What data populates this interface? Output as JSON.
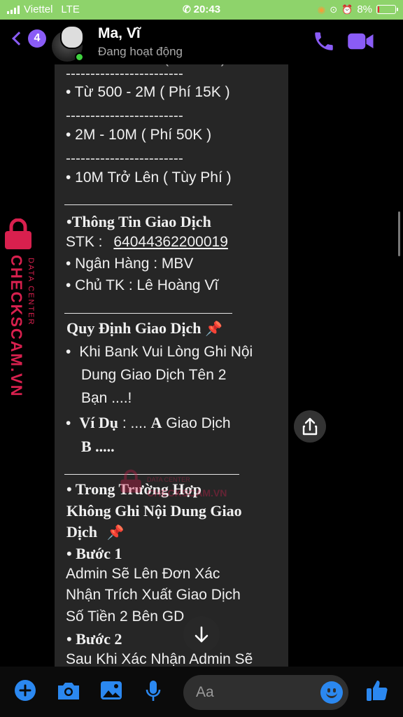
{
  "status_bar": {
    "carrier": "Viettel",
    "network": "LTE",
    "time": "20:43",
    "battery": "8%",
    "battery_level": 0.08
  },
  "header": {
    "back_count": "4",
    "contact_name": "Ma, Vĩ",
    "contact_status": "Đang hoạt động"
  },
  "message": {
    "separator": "------------------------",
    "tier_500_2m": "• Từ 500 - 2M ( Phí 15K )",
    "tier_2m_10m": "• 2M - 10M ( Phí 50K )",
    "tier_10m": "• 10M Trở Lên ( Tùy Phí )",
    "info_heading": "•Thông Tin Giao Dịch",
    "stk_label": "STK :",
    "stk_value": "64044362200019",
    "bank": "• Ngân Hàng : MBV",
    "owner": "• Chủ TK  : Lê Hoàng Vĩ",
    "rules_heading": "Quy Định Giao Dịch",
    "rule1_line1": "Khi Bank Vui Lòng Ghi Nội",
    "rule1_line2": "Dung Giao Dịch Tên 2",
    "rule1_line3": "Bạn ....!",
    "rule2_prefix": "Ví Dụ",
    "rule2_mid": " : .... ",
    "rule2_a": "A",
    "rule2_rest": " Giao Dịch",
    "rule2_b": "B .....",
    "case_line1": "• Trong Trường Hợp",
    "case_line2": "Không Ghi Nội Dung Giao",
    "case_line3": "Dịch",
    "step1": "• Bước 1",
    "step1_line1": "Admin Sẽ Lên Đơn Xác",
    "step1_line2": "Nhận Trích Xuất Giao Dịch",
    "step1_line3": "Số Tiền 2 Bên GD",
    "step2": "• Bước 2",
    "step2_line1": "Sau Khi Xác Nhận Admin Sẽ"
  },
  "watermark": {
    "brand": "CHECKSCAM.VN",
    "sub": "DATA CENTER",
    "center_brand": "CHECKSCAM.VN",
    "center_sub": "DATA CENTER"
  },
  "composer": {
    "placeholder": "Aa"
  },
  "colors": {
    "accent": "#8a5cf6",
    "status_bar": "#8ed36b",
    "composer_icons": "#2b88f0",
    "watermark": "#d8204e"
  }
}
